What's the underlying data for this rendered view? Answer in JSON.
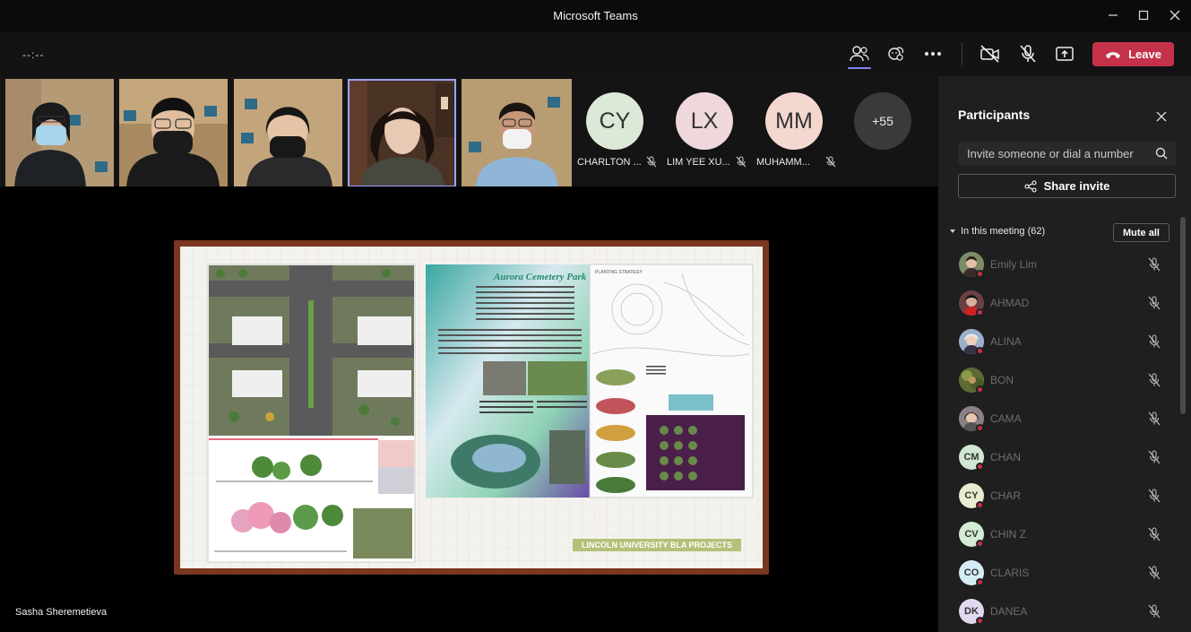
{
  "window": {
    "title": "Microsoft Teams",
    "controls": [
      "minimize-icon",
      "maximize-icon",
      "close-icon"
    ]
  },
  "toolbar": {
    "timer": "--:--",
    "leave_label": "Leave",
    "buttons": [
      "participants-icon",
      "reactions-icon",
      "more-options-icon",
      "camera-off-icon",
      "mic-off-icon",
      "share-screen-icon"
    ],
    "accent_color": "#7f85f5",
    "leave_color": "#c4314b"
  },
  "gallery": {
    "video_tiles": [
      {
        "id": "video-1"
      },
      {
        "id": "video-2"
      },
      {
        "id": "video-3"
      },
      {
        "id": "video-4",
        "active": true
      },
      {
        "id": "video-5"
      }
    ],
    "avatars": [
      {
        "initials": "CY",
        "name": "CHARLTON ...",
        "color": "#dce8d8",
        "muted": true
      },
      {
        "initials": "LX",
        "name": "LIM YEE XU...",
        "color": "#efd8dc",
        "muted": true
      },
      {
        "initials": "MM",
        "name": "MUHAMM...",
        "color": "#f4d7cf",
        "muted": true
      }
    ],
    "overflow_count": "+55"
  },
  "stage": {
    "presenter": "Sasha Sheremetieva",
    "slide": {
      "poster_title": "Aurora Cemetery Park",
      "poster_subtitle": "PLANTING STRATEGY",
      "banner": "LINCOLN UNIVERSITY BLA PROJECTS"
    }
  },
  "panel": {
    "title": "Participants",
    "search_placeholder": "Invite someone or dial a number",
    "share_label": "Share invite",
    "section_label": "In this meeting (62)",
    "mute_all_label": "Mute all",
    "participants": [
      {
        "name": "Emily Lim",
        "initials": "",
        "color": "#6b7a58"
      },
      {
        "name": "AHMAD",
        "initials": "",
        "color": "#5a3a3a"
      },
      {
        "name": "ALINA",
        "initials": "",
        "color": "#8aa0c0"
      },
      {
        "name": "BON",
        "initials": "",
        "color": "#6b6a3a"
      },
      {
        "name": "CAMA",
        "initials": "",
        "color": "#8a7a80"
      },
      {
        "name": "CHAN",
        "initials": "CM",
        "color": "#cfe6d4"
      },
      {
        "name": "CHAR",
        "initials": "CY",
        "color": "#e9edcf"
      },
      {
        "name": "CHIN Z",
        "initials": "CV",
        "color": "#d3ecd3"
      },
      {
        "name": "CLARIS",
        "initials": "CO",
        "color": "#d4ecf4"
      },
      {
        "name": "DANEA",
        "initials": "DK",
        "color": "#e2d8ef"
      }
    ]
  }
}
